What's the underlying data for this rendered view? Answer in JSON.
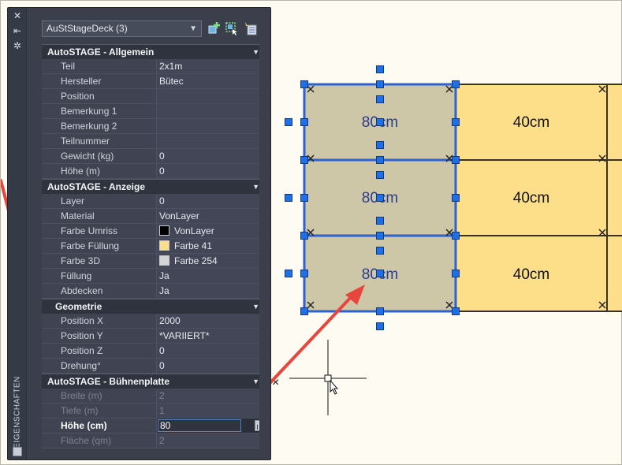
{
  "palette": {
    "strip_title": "EIGENSCHAFTEN",
    "selection": "AuStStageDeck (3)",
    "close_glyph": "✕",
    "pin_glyph": "⇤",
    "settings_glyph": "✲"
  },
  "categories": [
    {
      "title": "AutoSTAGE - Allgemein",
      "rows": [
        {
          "key": "Teil",
          "value": "2x1m"
        },
        {
          "key": "Hersteller",
          "value": "Bütec"
        },
        {
          "key": "Position",
          "value": ""
        },
        {
          "key": "Bemerkung 1",
          "value": ""
        },
        {
          "key": "Bemerkung 2",
          "value": ""
        },
        {
          "key": "Teilnummer",
          "value": ""
        },
        {
          "key": "Gewicht (kg)",
          "value": "0"
        },
        {
          "key": "Höhe (m)",
          "value": "0"
        }
      ]
    },
    {
      "title": "AutoSTAGE - Anzeige",
      "rows": [
        {
          "key": "Layer",
          "value": "0"
        },
        {
          "key": "Material",
          "value": "VonLayer"
        },
        {
          "key": "Farbe Umriss",
          "value": "VonLayer",
          "swatch": "#000000"
        },
        {
          "key": "Farbe Füllung",
          "value": "Farbe 41",
          "swatch": "#fddf8a"
        },
        {
          "key": "Farbe 3D",
          "value": "Farbe 254",
          "swatch": "#d4d4d4"
        },
        {
          "key": "Füllung",
          "value": "Ja"
        },
        {
          "key": "Abdecken",
          "value": "Ja"
        }
      ]
    },
    {
      "title": "Geometrie",
      "rows": [
        {
          "key": "Position X",
          "value": "2000"
        },
        {
          "key": "Position Y",
          "value": "*VARIIERT*"
        },
        {
          "key": "Position Z",
          "value": "0"
        },
        {
          "key": "Drehung°",
          "value": "0"
        }
      ]
    },
    {
      "title": "AutoSTAGE - Bühnenplatte",
      "rows": [
        {
          "key": "Breite (m)",
          "value": "2",
          "disabled": true
        },
        {
          "key": "Tiefe (m)",
          "value": "1",
          "disabled": true
        },
        {
          "key": "Höhe (cm)",
          "value": "80",
          "active": true
        },
        {
          "key": "Fläche (qm)",
          "value": "2",
          "disabled": true
        }
      ]
    }
  ],
  "drawing": {
    "selected_label": "80cm",
    "other_label": "40cm",
    "selected_fill": "#cdc7a8",
    "other_fill": "#fddf8a",
    "grip_color": "#1f6fe6",
    "arrow_color": "#e8453c"
  }
}
